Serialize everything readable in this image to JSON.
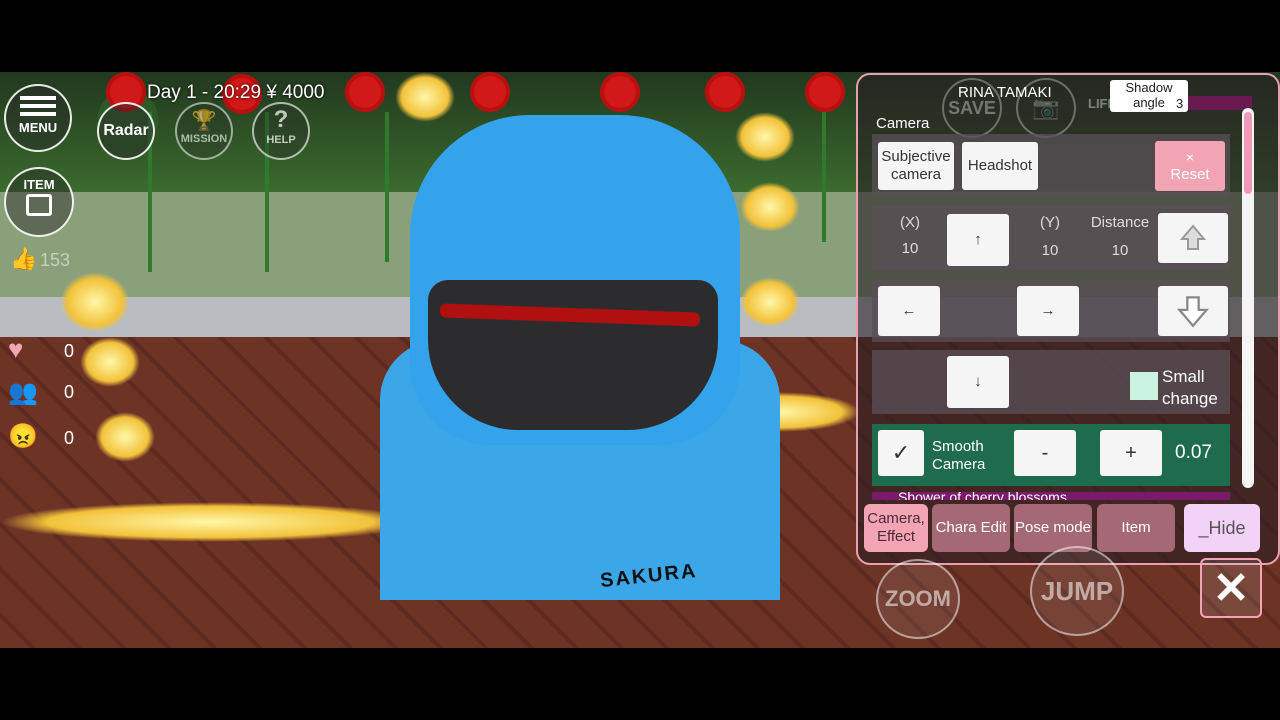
{
  "hud": {
    "day_time_money": "Day 1 - 20:29 ¥ 4000",
    "menu_label": "MENU",
    "radar_label": "Radar",
    "mission_label": "MISSION",
    "help_label": "HELP",
    "item_label": "ITEM",
    "likes_count": "153",
    "heart_count": "0",
    "friends_count": "0",
    "angry_count": "0"
  },
  "robot": {
    "body_text": "SAKURA"
  },
  "panel": {
    "character_name": "RINA TAMAKI",
    "save_label": "SAVE",
    "life_label": "LIFE",
    "shadow_angle_label": "Shadow angle",
    "shadow_angle_value": "3",
    "section_title": "Camera",
    "subjective_camera": "Subjective camera",
    "headshot": "Headshot",
    "reset_symbol": "×",
    "reset_label": "Reset",
    "x_label": "(X)",
    "x_value": "10",
    "y_label": "(Y)",
    "y_value": "10",
    "distance_label": "Distance",
    "distance_value": "10",
    "up_arrow": "↑",
    "left_arrow": "←",
    "right_arrow": "→",
    "down_arrow": "↓",
    "small_change_label": "Small change",
    "smooth_check": "✓",
    "smooth_camera_label": "Smooth Camera",
    "minus_label": "-",
    "plus_label": "+",
    "smooth_value": "0.07",
    "next_row_partial": "Shower of cherry blossoms"
  },
  "tabs": {
    "camera_effect": "Camera, Effect",
    "chara_edit": "Chara Edit",
    "pose_mode": "Pose mode",
    "item": "Item",
    "hide": "_Hide"
  },
  "controls": {
    "zoom_label": "ZOOM",
    "jump_label": "JUMP",
    "close_symbol": "✕"
  },
  "colors": {
    "accent_pink": "#f3a4b4",
    "smooth_row_green": "#1f6b4e",
    "robot_blue": "#35a3ec"
  }
}
